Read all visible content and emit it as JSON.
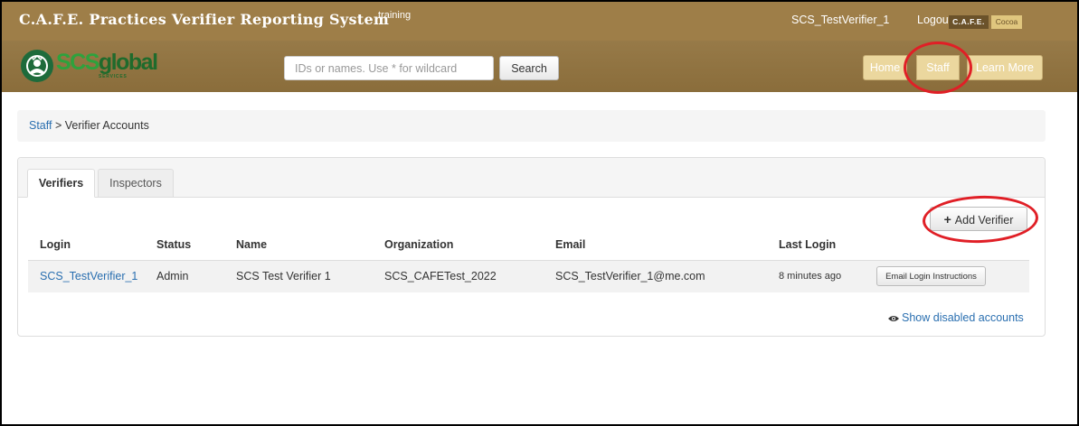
{
  "header": {
    "title": "C.A.F.E. Practices Verifier Reporting System",
    "env": "training",
    "user": "SCS_TestVerifier_1",
    "logout": "Logout",
    "badge_cafe": "C.A.F.E.",
    "badge_cocoa": "Cocoa"
  },
  "nav": {
    "logo_scs": "SCS",
    "logo_global": "global",
    "logo_sub": "SERVICES",
    "search_placeholder": "IDs or names. Use * for wildcard",
    "search_label": "Search",
    "items": [
      {
        "label": "Home"
      },
      {
        "label": "Staff"
      },
      {
        "label": "Learn More"
      }
    ]
  },
  "breadcrumb": {
    "link": "Staff",
    "separator": " > ",
    "current": "Verifier Accounts"
  },
  "tabs": [
    {
      "label": "Verifiers",
      "active": true
    },
    {
      "label": "Inspectors",
      "active": false
    }
  ],
  "actions": {
    "add_verifier": "Add Verifier",
    "show_disabled": "Show disabled accounts"
  },
  "table": {
    "columns": [
      "Login",
      "Status",
      "Name",
      "Organization",
      "Email",
      "Last Login"
    ],
    "rows": [
      {
        "login": "SCS_TestVerifier_1",
        "status": "Admin",
        "name": "SCS Test Verifier 1",
        "organization": "SCS_CAFETest_2022",
        "email": "SCS_TestVerifier_1@me.com",
        "last_login": "8 minutes ago",
        "action": "Email Login Instructions"
      }
    ]
  },
  "colors": {
    "topbar": "#9e7e48",
    "nav_button": "#ebd79e",
    "link": "#2a6fb0",
    "annotation": "#e01f26"
  }
}
